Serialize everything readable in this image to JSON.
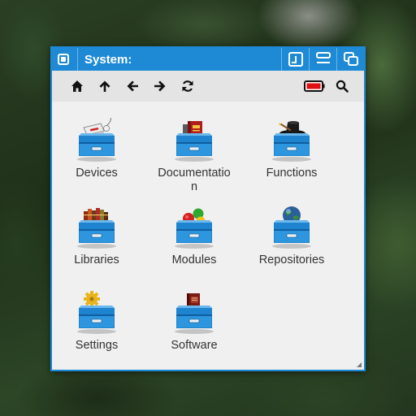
{
  "window": {
    "title": "System:"
  },
  "colors": {
    "accent": "#1e8ad6",
    "drawer_blue": "#1f84cf",
    "battery_red": "#e01010"
  },
  "title_buttons": [
    {
      "icon": "zoom-icon"
    },
    {
      "icon": "resize-icon"
    },
    {
      "icon": "depth-icon"
    }
  ],
  "toolbar": {
    "tools": [
      {
        "icon": "home-icon"
      },
      {
        "icon": "arrow-up-icon"
      },
      {
        "icon": "arrow-left-icon"
      },
      {
        "icon": "arrow-right-icon"
      },
      {
        "icon": "refresh-icon"
      }
    ],
    "right_tools": [
      {
        "icon": "battery-icon"
      },
      {
        "icon": "search-icon"
      }
    ]
  },
  "items": [
    {
      "label": "Devices",
      "icon": "devices-drawer-icon"
    },
    {
      "label": "Documentation",
      "icon": "documentation-drawer-icon"
    },
    {
      "label": "Functions",
      "icon": "functions-drawer-icon"
    },
    {
      "label": "Libraries",
      "icon": "libraries-drawer-icon"
    },
    {
      "label": "Modules",
      "icon": "modules-drawer-icon"
    },
    {
      "label": "Repositories",
      "icon": "repositories-drawer-icon"
    },
    {
      "label": "Settings",
      "icon": "settings-drawer-icon"
    },
    {
      "label": "Software",
      "icon": "software-drawer-icon"
    }
  ]
}
